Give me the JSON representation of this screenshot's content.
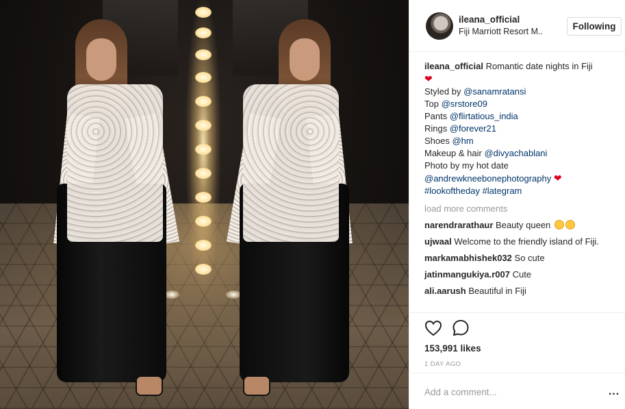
{
  "post": {
    "username": "ileana_official",
    "location": "Fiji Marriott Resort M..",
    "follow_label": "Following",
    "caption_user": "ileana_official",
    "caption_text": "Romantic date nights in Fiji",
    "caption_lines": [
      {
        "prefix": "Styled by ",
        "link": "@sanamratansi"
      },
      {
        "prefix": "Top ",
        "link": "@srstore09"
      },
      {
        "prefix": "Pants ",
        "link": "@flirtatious_india"
      },
      {
        "prefix": "Rings ",
        "link": "@forever21"
      },
      {
        "prefix": "Shoes ",
        "link": "@hm"
      },
      {
        "prefix": "Makeup & hair ",
        "link": "@divyachablani"
      },
      {
        "prefix": "Photo by my hot date",
        "link": ""
      }
    ],
    "photographer": "@andrewkneebonephotography",
    "hashtags": "#lookoftheday #lategram",
    "load_more": "load more comments",
    "comments": [
      {
        "user": "narendrarathaur",
        "text": "Beauty queen"
      },
      {
        "user": "ujwaal",
        "text": "Welcome to the friendly island of Fiji."
      },
      {
        "user": "markamabhishek032",
        "text": "So cute"
      },
      {
        "user": "jatinmangukiya.r007",
        "text": "Cute"
      },
      {
        "user": "ali.aarush",
        "text": "Beautiful in Fiji"
      }
    ],
    "likes": "153,991 likes",
    "timestamp": "1 DAY AGO",
    "comment_placeholder": "Add a comment...",
    "more_label": "..."
  },
  "icons": {
    "like": "heart-outline-icon",
    "comment": "speech-bubble-icon",
    "heart_emoji": "red-heart-icon",
    "kiss_emoji": "kissing-face-icon"
  },
  "colors": {
    "link": "#003569",
    "muted": "#999999",
    "text": "#262626",
    "heart": "#e0001b",
    "border": "#efefef"
  }
}
